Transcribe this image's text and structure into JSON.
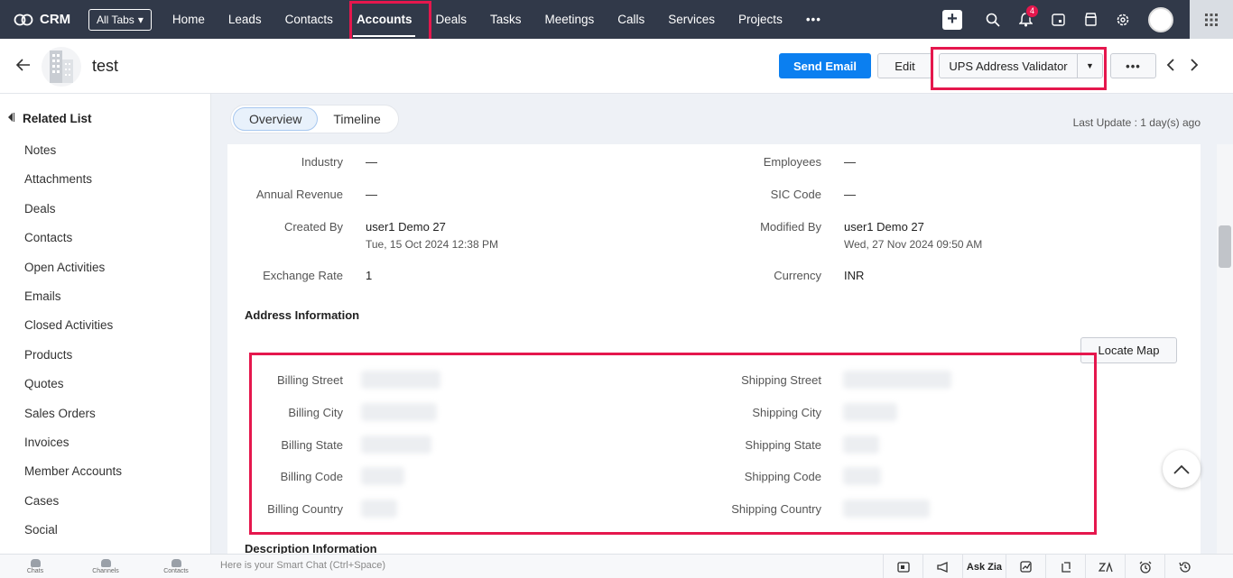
{
  "topnav": {
    "app_name": "CRM",
    "all_tabs_label": "All Tabs",
    "tabs": [
      "Home",
      "Leads",
      "Contacts",
      "Accounts",
      "Deals",
      "Tasks",
      "Meetings",
      "Calls",
      "Services",
      "Projects"
    ],
    "active_tab": "Accounts",
    "more_label": "•••",
    "notification_count": "4"
  },
  "record": {
    "title": "test",
    "send_email_label": "Send Email",
    "edit_label": "Edit",
    "ups_label": "UPS Address Validator",
    "more_label": "•••"
  },
  "sidebar": {
    "title": "Related List",
    "items": [
      "Notes",
      "Attachments",
      "Deals",
      "Contacts",
      "Open Activities",
      "Emails",
      "Closed Activities",
      "Products",
      "Quotes",
      "Sales Orders",
      "Invoices",
      "Member Accounts",
      "Cases",
      "Social"
    ]
  },
  "tabs": {
    "overview": "Overview",
    "timeline": "Timeline",
    "last_update": "Last Update : 1 day(s) ago"
  },
  "fields": {
    "industry": {
      "label": "Industry",
      "value": "—"
    },
    "employees": {
      "label": "Employees",
      "value": "—"
    },
    "annual_revenue": {
      "label": "Annual Revenue",
      "value": "—"
    },
    "sic_code": {
      "label": "SIC Code",
      "value": "—"
    },
    "created_by": {
      "label": "Created By",
      "value": "user1 Demo 27",
      "date": "Tue, 15 Oct 2024 12:38 PM"
    },
    "modified_by": {
      "label": "Modified By",
      "value": "user1 Demo 27",
      "date": "Wed, 27 Nov 2024 09:50 AM"
    },
    "exchange_rate": {
      "label": "Exchange Rate",
      "value": "1"
    },
    "currency": {
      "label": "Currency",
      "value": "INR"
    }
  },
  "address": {
    "section_title": "Address Information",
    "locate_map_label": "Locate Map",
    "billing_labels": [
      "Billing Street",
      "Billing City",
      "Billing State",
      "Billing Code",
      "Billing Country"
    ],
    "shipping_labels": [
      "Shipping Street",
      "Shipping City",
      "Shipping State",
      "Shipping Code",
      "Shipping Country"
    ]
  },
  "description": {
    "section_title": "Description Information"
  },
  "bottombar": {
    "chats": "Chats",
    "channels": "Channels",
    "contacts": "Contacts",
    "smart_chat_placeholder": "Here is your Smart Chat (Ctrl+Space)",
    "ask_zia": "Ask Zia"
  },
  "colors": {
    "highlight": "#e5174d",
    "primary": "#0b7ff0",
    "nav_bg": "#313949"
  }
}
